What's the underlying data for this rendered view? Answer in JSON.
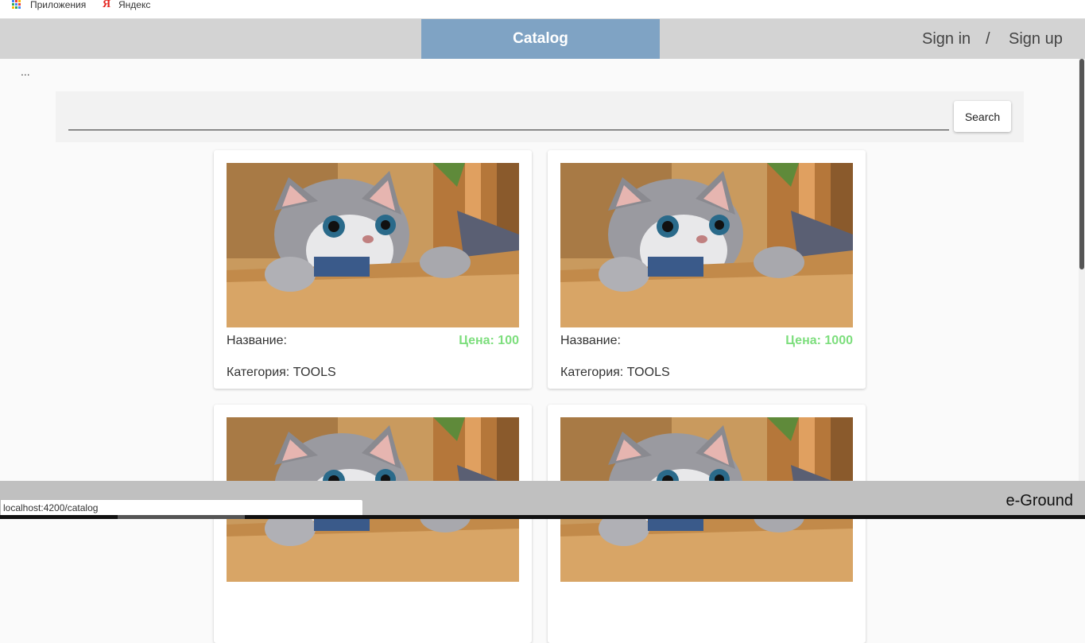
{
  "bookmarks": {
    "apps_label": "Приложения",
    "yandex_label": "Яндекс",
    "yandex_glyph": "Я"
  },
  "header": {
    "catalog_label": "Catalog",
    "sign_in": "Sign in",
    "separator": "/",
    "sign_up": "Sign up"
  },
  "breadcrumb": "...",
  "search": {
    "value": "",
    "placeholder": "",
    "button_label": "Search"
  },
  "products": [
    {
      "name": "Название:",
      "price": "Цена: 100",
      "category": "Категория: TOOLS"
    },
    {
      "name": "Название:",
      "price": "Цена: 1000",
      "category": "Категория: TOOLS"
    },
    {
      "name": "",
      "price": "",
      "category": ""
    },
    {
      "name": "",
      "price": "",
      "category": ""
    }
  ],
  "footer": {
    "brand": "e-Ground",
    "status_url": "localhost:4200/catalog"
  },
  "colors": {
    "accent": "#7fa3c4",
    "price": "#7dde7d",
    "header_bg": "#d3d3d3",
    "footer_bg": "#c0c0c0"
  }
}
